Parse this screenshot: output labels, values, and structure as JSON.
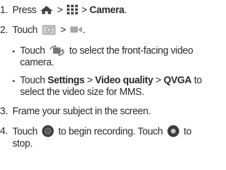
{
  "steps": [
    {
      "num": "1.",
      "pre": "Press",
      "sep1": ">",
      "sep2": ">",
      "bold": "Camera",
      "end": ".",
      "icons": [
        "home-icon",
        "apps-grid-icon"
      ]
    },
    {
      "num": "2.",
      "pre": "Touch",
      "sep": ">",
      "end": ".",
      "icons": [
        "camera-mode-icon",
        "video-mode-icon"
      ]
    },
    {
      "num": "3.",
      "text": "Frame your subject in the screen."
    },
    {
      "num": "4.",
      "pre": "Touch",
      "mid": "to begin recording. Touch",
      "post": "to",
      "line2": "stop.",
      "icons": [
        "record-button-icon",
        "stop-button-icon"
      ]
    }
  ],
  "sub": [
    {
      "bullet": "▪",
      "pre": "Touch",
      "post": "to select the front-facing video",
      "line2": "camera.",
      "icon": "switch-camera-icon"
    },
    {
      "bullet": "▪",
      "pre": "Touch",
      "b1": "Settings",
      "s1": ">",
      "b2": "Video quality",
      "s2": ">",
      "b3": "QVGA",
      "post": "to",
      "line2": "select the video size for MMS."
    }
  ],
  "colors": {
    "text": "#2a2a2a",
    "icon_dark": "#444444",
    "icon_grey": "#9a9a9a"
  }
}
